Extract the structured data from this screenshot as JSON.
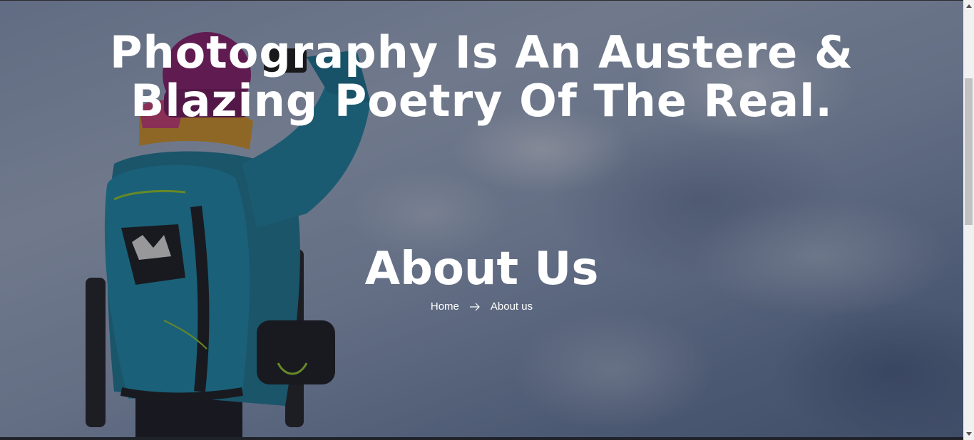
{
  "hero": {
    "quote": "Photography Is An Austere & Blazing Poetry Of The Real.",
    "page_title": "About Us",
    "breadcrumb": {
      "home": "Home",
      "separator_icon": "arrow-right-icon",
      "current": "About us"
    }
  },
  "colors": {
    "text": "#ffffff",
    "scrollbar_track": "#f1f1f1",
    "scrollbar_thumb": "#c1c1c1"
  },
  "scrollbar": {
    "up_icon": "triangle-up-icon",
    "down_icon": "triangle-down-icon"
  }
}
